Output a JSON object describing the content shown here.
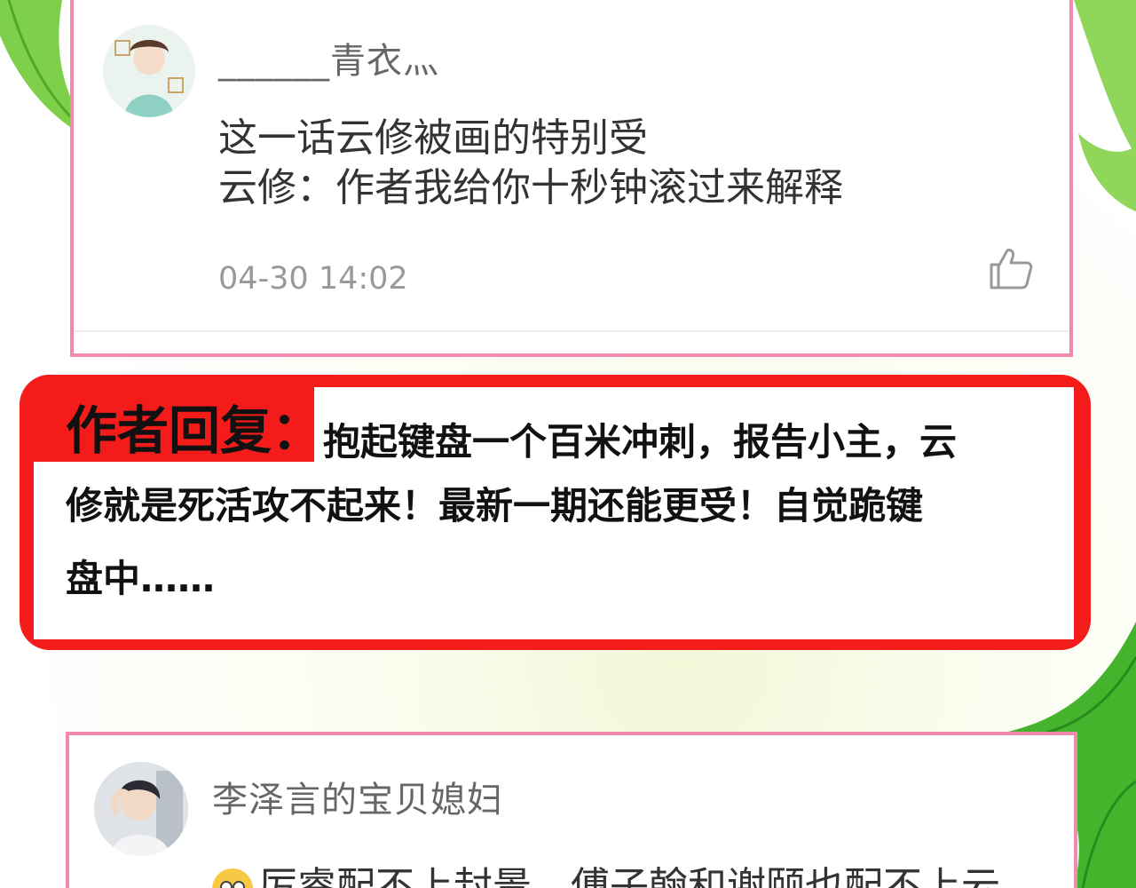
{
  "comments": [
    {
      "username": "______青衣灬",
      "lines": [
        "这一话云修被画的特别受",
        "云修：作者我给你十秒钟滚过来解释"
      ],
      "timestamp": "04-30 14:02",
      "like_icon": "thumbs-up-icon"
    },
    {
      "username": "李泽言的宝贝媳妇",
      "line": "厉睿配不上封景，傅子翰和谢颐也配不上云"
    }
  ],
  "author_reply": {
    "label": "作者回复：",
    "lines": [
      "抱起键盘一个百米冲刺，报告小主，云",
      "修就是死活攻不起来！最新一期还能更受！自觉跪键",
      "盘中……"
    ]
  },
  "colors": {
    "card_border": "#f08ab0",
    "reply_red": "#f41b1b",
    "leaf_green": "#6cc93c"
  }
}
